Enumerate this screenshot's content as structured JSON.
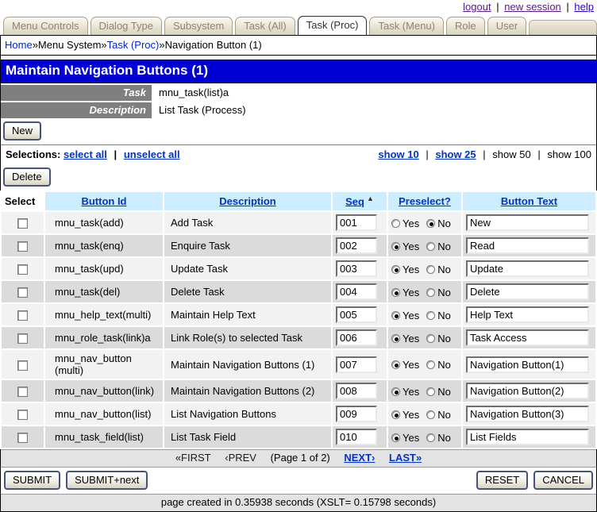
{
  "top_bar": {
    "logout": "logout",
    "new_session": "new session",
    "help": "help",
    "separator": "|"
  },
  "tabs": [
    {
      "label": "Menu Controls",
      "active": false
    },
    {
      "label": "Dialog Type",
      "active": false
    },
    {
      "label": "Subsystem",
      "active": false
    },
    {
      "label": "Task (All)",
      "active": false
    },
    {
      "label": "Task (Proc)",
      "active": true
    },
    {
      "label": "Task (Menu)",
      "active": false
    },
    {
      "label": "Role",
      "active": false
    },
    {
      "label": "User",
      "active": false
    }
  ],
  "breadcrumb": {
    "separator": "»",
    "items": [
      {
        "label": "Home",
        "is_link": true
      },
      {
        "label": "Menu System",
        "is_link": false
      },
      {
        "label": "Task (Proc)",
        "is_link": true
      },
      {
        "label": "Navigation Button (1)",
        "is_link": false
      }
    ]
  },
  "title_bar": {
    "title": "Maintain Navigation Buttons (1)"
  },
  "details": {
    "task": {
      "label": "Task",
      "value": "mnu_task(list)a"
    },
    "description": {
      "label": "Description",
      "value": "List Task (Process)"
    }
  },
  "toolbar": {
    "new_label": "New",
    "delete_label": "Delete"
  },
  "selections": {
    "label": "Selections:",
    "select_all": "select all",
    "unselect_all": "unselect all",
    "separator": "|",
    "show": [
      {
        "label": "show 10",
        "link": true
      },
      {
        "label": "show 25",
        "link": true
      },
      {
        "label": "show 50",
        "link": false
      },
      {
        "label": "show 100",
        "link": false
      }
    ]
  },
  "table": {
    "headers": {
      "select": "Select",
      "button_id": "Button Id",
      "description": "Description",
      "seq": "Seq",
      "preselect": "Preselect?",
      "button_text": "Button Text"
    },
    "sort_arrow": "▲",
    "sort_column": "Seq",
    "yes_label": "Yes",
    "no_label": "No",
    "rows": [
      {
        "button_id": "mnu_task(add)",
        "description": "Add Task",
        "seq": "001",
        "preselect": "No",
        "button_text": "New"
      },
      {
        "button_id": "mnu_task(enq)",
        "description": "Enquire Task",
        "seq": "002",
        "preselect": "Yes",
        "button_text": "Read"
      },
      {
        "button_id": "mnu_task(upd)",
        "description": "Update Task",
        "seq": "003",
        "preselect": "Yes",
        "button_text": "Update"
      },
      {
        "button_id": "mnu_task(del)",
        "description": "Delete Task",
        "seq": "004",
        "preselect": "Yes",
        "button_text": "Delete"
      },
      {
        "button_id": "mnu_help_text(multi)",
        "description": "Maintain Help Text",
        "seq": "005",
        "preselect": "Yes",
        "button_text": "Help Text"
      },
      {
        "button_id": "mnu_role_task(link)a",
        "description": "Link Role(s) to selected Task",
        "seq": "006",
        "preselect": "Yes",
        "button_text": "Task Access"
      },
      {
        "button_id": "mnu_nav_button (multi)",
        "description": "Maintain Navigation Buttons (1)",
        "seq": "007",
        "preselect": "Yes",
        "button_text": "Navigation Button(1)"
      },
      {
        "button_id": "mnu_nav_button(link)",
        "description": "Maintain Navigation Buttons (2)",
        "seq": "008",
        "preselect": "Yes",
        "button_text": "Navigation Button(2)"
      },
      {
        "button_id": "mnu_nav_button(list)",
        "description": "List Navigation Buttons",
        "seq": "009",
        "preselect": "Yes",
        "button_text": "Navigation Button(3)"
      },
      {
        "button_id": "mnu_task_field(list)",
        "description": "List Task Field",
        "seq": "010",
        "preselect": "Yes",
        "button_text": "List Fields"
      }
    ]
  },
  "pagination": {
    "first": "«FIRST",
    "prev": "‹PREV",
    "page_info": "(Page 1 of 2)",
    "next": "NEXT›",
    "last": "LAST»"
  },
  "actions": {
    "submit": "SUBMIT",
    "submit_next": "SUBMIT+next",
    "reset": "RESET",
    "cancel": "CANCEL"
  },
  "footer": {
    "text": "page created in 0.35938 seconds (XSLT= 0.15798 seconds)"
  },
  "colors": {
    "banner_blue": "#0000D4",
    "link_blue": "#0033CC",
    "visited_purple": "#551A8B",
    "tab_tan": "#D9D3BC",
    "table_header_blue": "#CDEEFF",
    "row_light": "#F2F2F2",
    "row_dark": "#DBDBDB",
    "label_gray": "#7F7F7F"
  }
}
